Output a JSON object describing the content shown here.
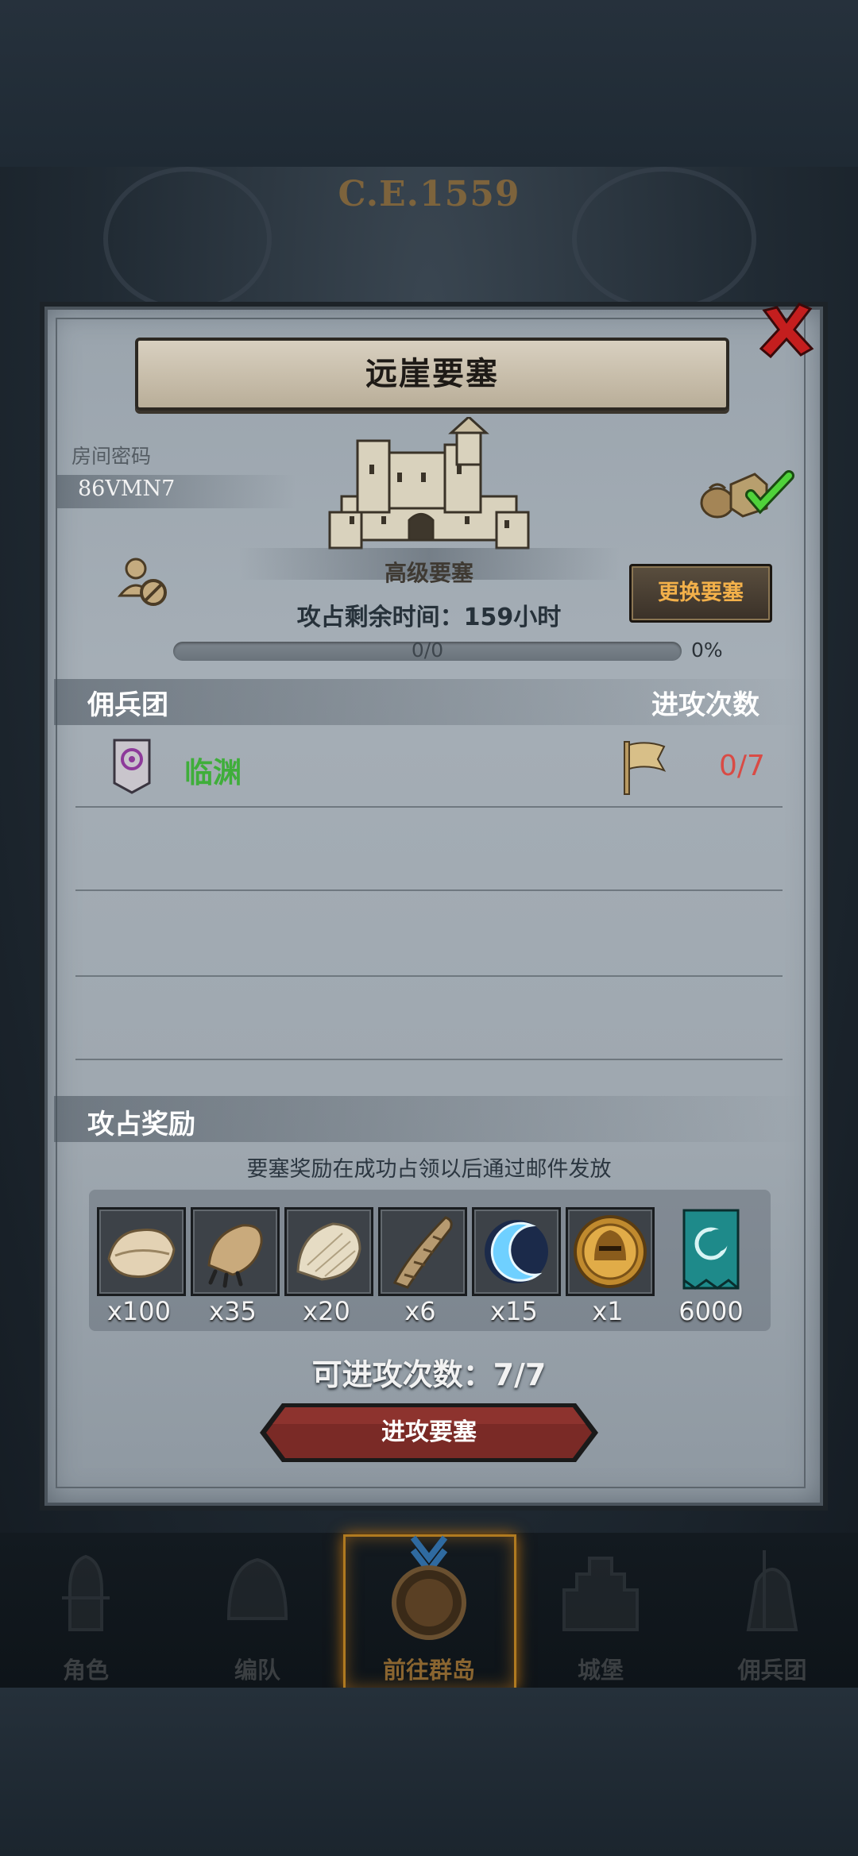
{
  "background": {
    "year_banner": "C.E.1559"
  },
  "dialog": {
    "title": "远崖要塞",
    "room_code_label": "房间密码",
    "room_code": "86VMN7",
    "fortress_grade": "高级要塞",
    "change_fortress_button": "更换要塞",
    "time_remaining": "攻占剩余时间：159小时",
    "progress": {
      "text": "0/0",
      "percent_label": "0%",
      "fraction": 0
    },
    "mercenary_header": "佣兵团",
    "attack_count_header": "进攻次数",
    "guild": {
      "name": "临渊",
      "attack_count": "0/7"
    },
    "reward_header": "攻占奖励",
    "reward_note": "要塞奖励在成功占领以后通过邮件发放",
    "rewards": [
      {
        "icon": "pelt-icon",
        "qty": "x100"
      },
      {
        "icon": "claw-icon",
        "qty": "x35"
      },
      {
        "icon": "fur-scrap-icon",
        "qty": "x20"
      },
      {
        "icon": "horn-icon",
        "qty": "x6"
      },
      {
        "icon": "crescent-moon-icon",
        "qty": "x15"
      },
      {
        "icon": "gold-helmet-coin-icon",
        "qty": "x1"
      },
      {
        "icon": "guild-banner-icon",
        "qty": "6000"
      }
    ],
    "attempts": "可进攻次数：7/7",
    "attack_button": "进攻要塞"
  },
  "bottom_nav": [
    {
      "label": "角色",
      "icon": "knight-icon",
      "active": false
    },
    {
      "label": "编队",
      "icon": "helmet-icon",
      "active": false
    },
    {
      "label": "前往群岛",
      "icon": "compass-icon",
      "active": true
    },
    {
      "label": "城堡",
      "icon": "castle-icon",
      "active": false
    },
    {
      "label": "佣兵团",
      "icon": "mercenary-icon",
      "active": false
    }
  ],
  "colors": {
    "guild_name": "#3fae3a",
    "attack_count": "#d94b45",
    "change_button_text": "#f2b04a",
    "attack_button": "#7a2a26",
    "active_nav": "#b07a20"
  }
}
